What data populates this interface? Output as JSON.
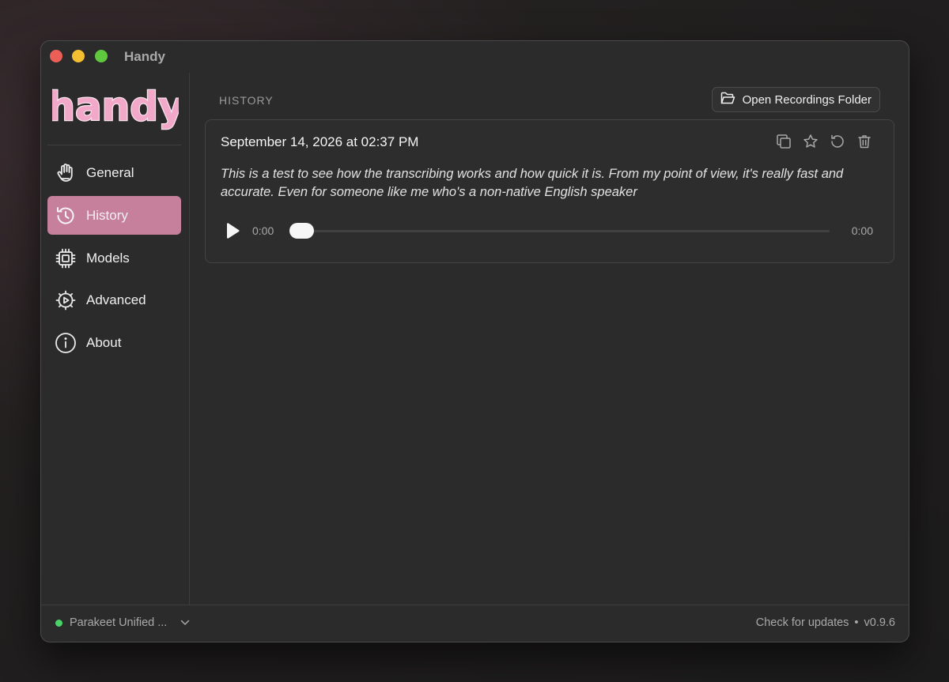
{
  "window": {
    "title": "Handy"
  },
  "sidebar": {
    "logo_text": "handy",
    "items": [
      {
        "label": "General",
        "icon": "hand-icon"
      },
      {
        "label": "History",
        "icon": "history-icon",
        "active": true
      },
      {
        "label": "Models",
        "icon": "cpu-chip-icon"
      },
      {
        "label": "Advanced",
        "icon": "gear-play-icon"
      },
      {
        "label": "About",
        "icon": "info-icon"
      }
    ]
  },
  "main": {
    "section_title": "HISTORY",
    "open_folder_label": "Open Recordings Folder",
    "entry": {
      "date": "September 14, 2026 at 02:37 PM",
      "text": "This is a test to see how the transcribing works and how quick it is. From my point of view, it's really fast and accurate. Even for someone like me who's a non-native English speaker",
      "current_time": "0:00",
      "total_time": "0:00",
      "progress": 0
    }
  },
  "footer": {
    "model_name": "Parakeet Unified ...",
    "model_status_color": "#4bd36a",
    "check_updates_label": "Check for updates",
    "separator": "•",
    "version": "v0.9.6"
  },
  "colors": {
    "accent": "#c6809c",
    "logo_pink": "#f1a8c9",
    "background": "#2b2b2b"
  }
}
